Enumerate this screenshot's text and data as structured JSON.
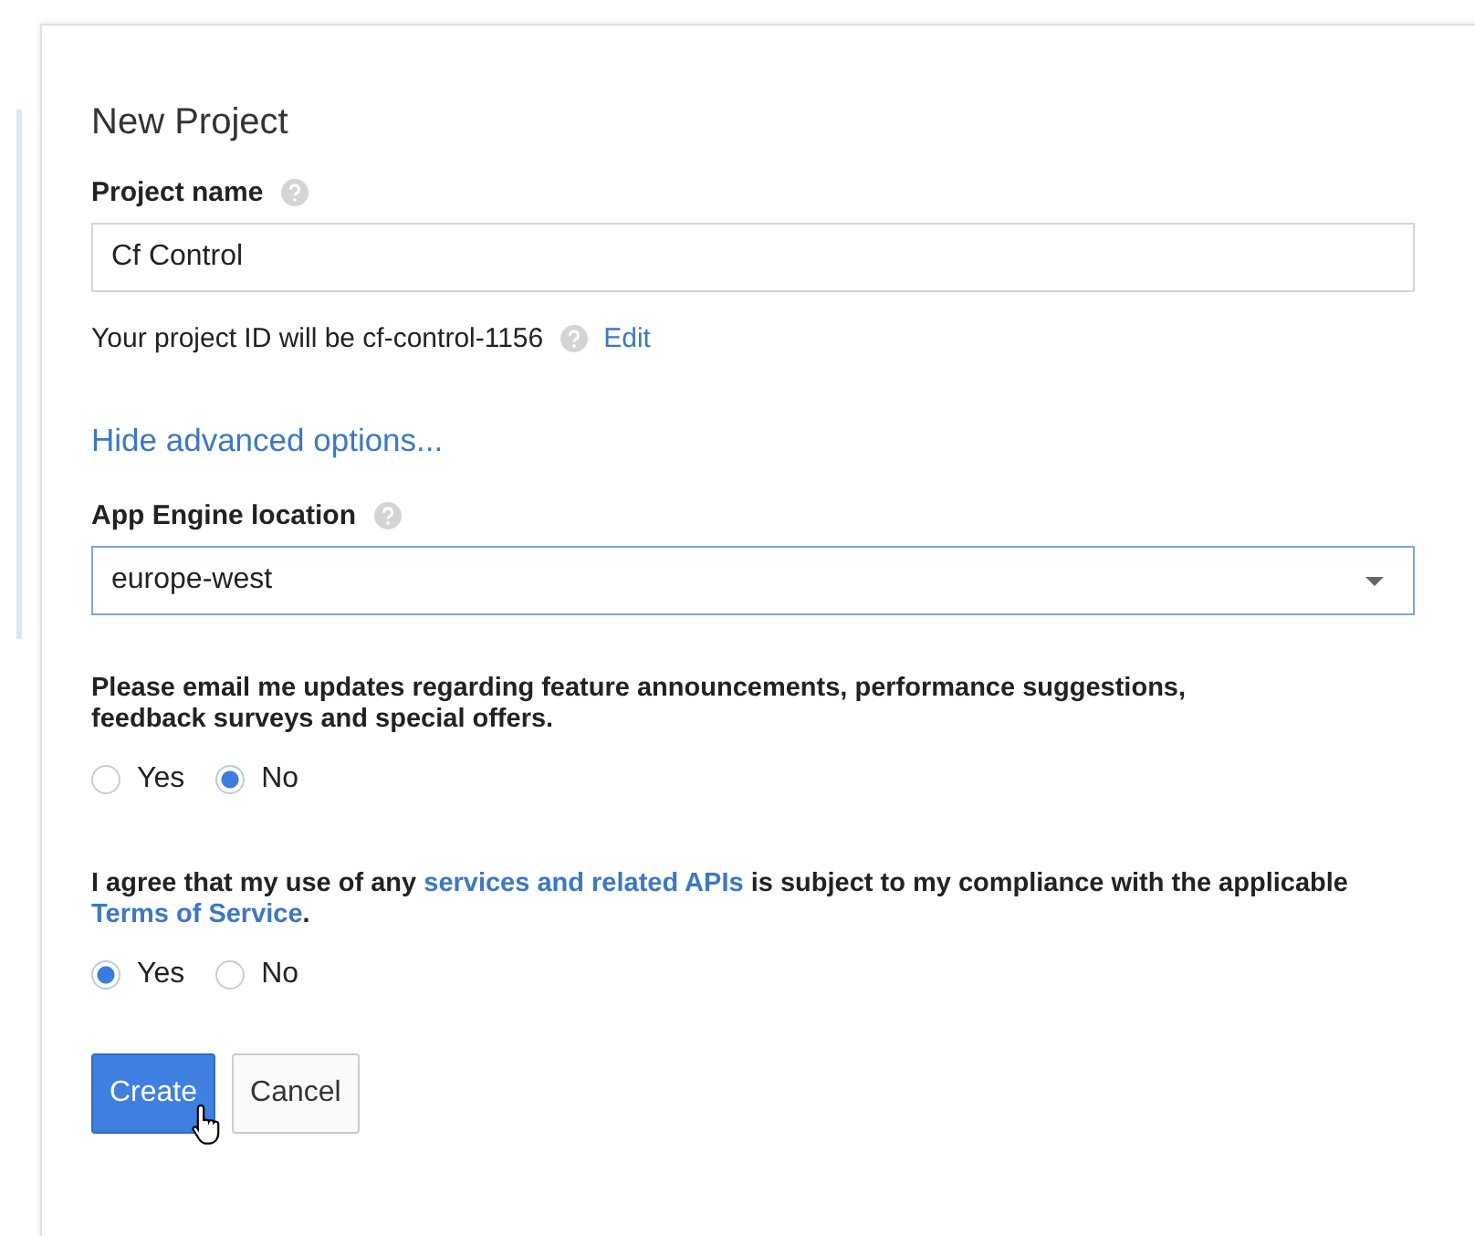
{
  "dialog": {
    "title": "New Project",
    "project_name": {
      "label": "Project name",
      "value": "Cf Control"
    },
    "project_id": {
      "text": "Your project ID will be cf-control-1156",
      "edit_link": "Edit"
    },
    "advanced_link": "Hide advanced options...",
    "location": {
      "label": "App Engine location",
      "value": "europe-west"
    },
    "email_question": {
      "text": "Please email me updates regarding feature announcements, performance suggestions, feedback surveys and special offers.",
      "options": [
        {
          "label": "Yes",
          "selected": false
        },
        {
          "label": "No",
          "selected": true
        }
      ]
    },
    "terms_question": {
      "before": "I agree that my use of any ",
      "link1": "services and related APIs",
      "middle": " is subject to my compliance with the applicable ",
      "link2": "Terms of Service",
      "after": ".",
      "options": [
        {
          "label": "Yes",
          "selected": true
        },
        {
          "label": "No",
          "selected": false
        }
      ]
    },
    "buttons": [
      {
        "label": "Create",
        "kind": "primary"
      },
      {
        "label": "Cancel",
        "kind": "secondary"
      }
    ]
  }
}
